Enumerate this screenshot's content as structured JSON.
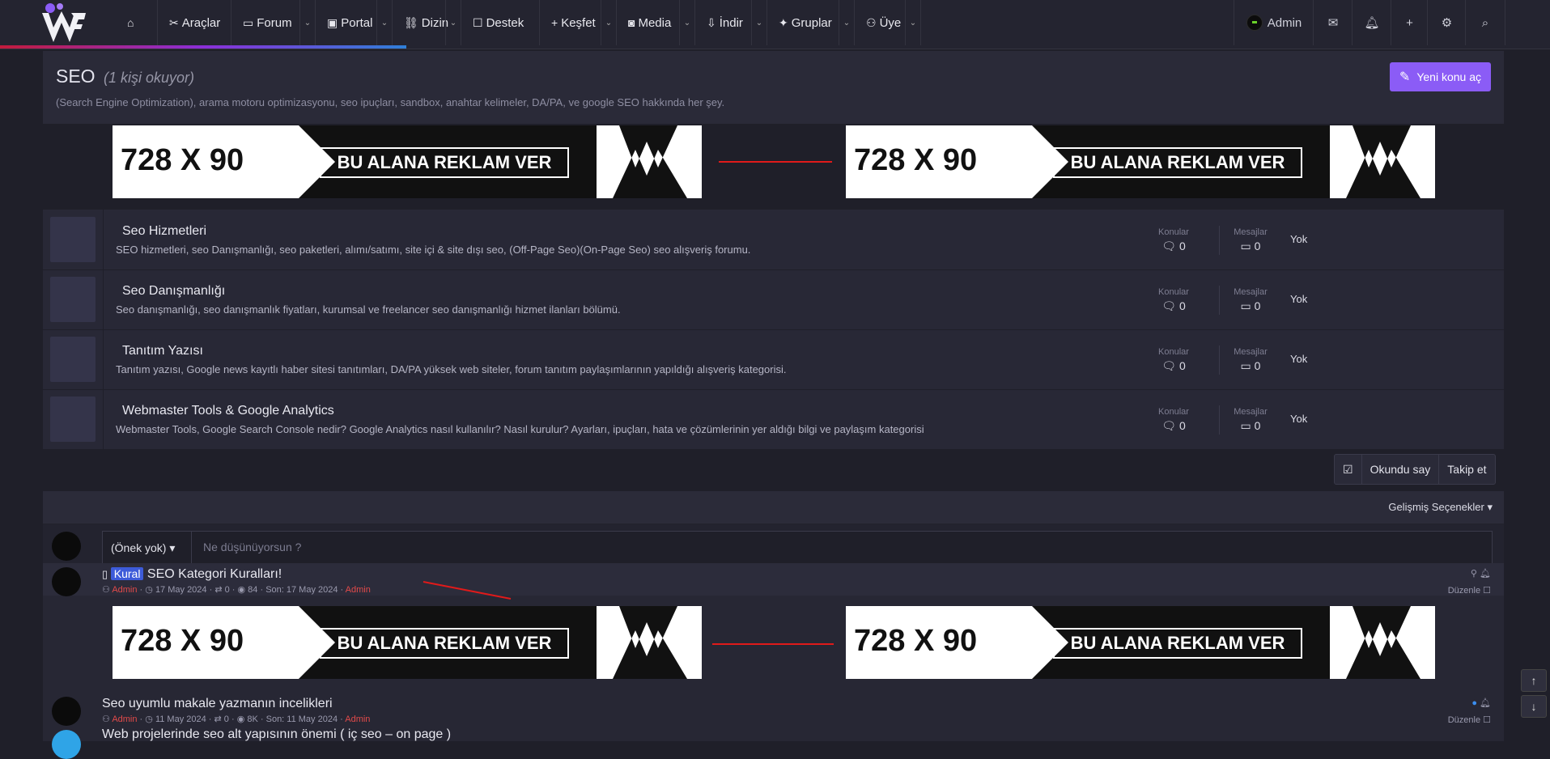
{
  "nav": {
    "items": [
      {
        "label": "Araçlar",
        "icon": "tools-icon",
        "dropdown": false
      },
      {
        "label": "Forum",
        "icon": "comment-icon",
        "dropdown": true
      },
      {
        "label": "Portal",
        "icon": "portal-icon",
        "dropdown": true
      },
      {
        "label": "Dizin",
        "icon": "link-icon",
        "dropdown": true
      },
      {
        "label": "Destek",
        "icon": "support-icon",
        "dropdown": false
      },
      {
        "label": "Keşfet",
        "icon": "plus-icon",
        "dropdown": true
      },
      {
        "label": "Media",
        "icon": "camera-icon",
        "dropdown": true
      },
      {
        "label": "İndir",
        "icon": "download-icon",
        "dropdown": true
      },
      {
        "label": "Gruplar",
        "icon": "group-icon",
        "dropdown": true
      },
      {
        "label": "Üye",
        "icon": "members-icon",
        "dropdown": true
      }
    ],
    "user": "Admin"
  },
  "header": {
    "title": "SEO",
    "subtitle": "(1 kişi okuyor)",
    "description": "(Search Engine Optimization), arama motoru optimizasyonu, seo ipuçları, sandbox, anahtar kelimeler, DA/PA, ve google SEO hakkında her şey.",
    "new_thread": "Yeni konu aç"
  },
  "ads": {
    "size": "728 X 90",
    "slogan": "BU ALANA REKLAM VER"
  },
  "nodes": [
    {
      "title": "Seo Hizmetleri",
      "desc": "SEO hizmetleri, seo Danışmanlığı, seo paketleri, alımı/satımı, site içi & site dışı seo, (Off-Page Seo)(On-Page Seo) seo alışveriş forumu.",
      "threads": "0",
      "messages": "0",
      "last": "Yok"
    },
    {
      "title": "Seo Danışmanlığı",
      "desc": "Seo danışmanlığı, seo danışmanlık fiyatları, kurumsal ve freelancer seo danışmanlığı hizmet ilanları bölümü.",
      "threads": "0",
      "messages": "0",
      "last": "Yok"
    },
    {
      "title": "Tanıtım Yazısı",
      "desc": "Tanıtım yazısı, Google news kayıtlı haber sitesi tanıtımları, DA/PA yüksek web siteler, forum tanıtım paylaşımlarının yapıldığı alışveriş kategorisi.",
      "threads": "0",
      "messages": "0",
      "last": "Yok"
    },
    {
      "title": "Webmaster Tools & Google Analytics",
      "desc": "Webmaster Tools, Google Search Console nedir? Google Analytics nasıl kullanılır? Nasıl kurulur? Ayarları, ipuçları, hata ve çözümlerinin yer aldığı bilgi ve paylaşım kategorisi",
      "threads": "0",
      "messages": "0",
      "last": "Yok"
    }
  ],
  "stat_labels": {
    "threads": "Konular",
    "messages": "Mesajlar"
  },
  "actions": {
    "mark_read": "Okundu say",
    "watch": "Takip et"
  },
  "filter": {
    "advanced": "Gelişmiş Seçenekler"
  },
  "quick_thread": {
    "prefix": "(Önek yok)",
    "placeholder": "Ne düşünüyorsun ?"
  },
  "threads": [
    {
      "badge": "Kural",
      "title": "SEO Kategori Kuralları!",
      "author": "Admin",
      "date": "17 May 2024",
      "replies": "0",
      "views": "84",
      "last_label": "Son: 17 May 2024",
      "last_user": "Admin",
      "edit": "Düzenle"
    },
    {
      "badge": "",
      "title": "Seo uyumlu makale yazmanın incelikleri",
      "author": "Admin",
      "date": "11 May 2024",
      "replies": "0",
      "views": "8K",
      "last_label": "Son: 11 May 2024",
      "last_user": "Admin",
      "edit": "Düzenle"
    },
    {
      "badge": "",
      "title": "Web projelerinde seo alt yapısının önemi ( iç seo – on page )",
      "author": "",
      "date": "",
      "replies": "",
      "views": "",
      "last_label": "",
      "last_user": "",
      "edit": ""
    }
  ],
  "colors": {
    "accent": "#8b5cf6",
    "bg": "#1f1f29",
    "panel": "#282836",
    "user": "#e24a4a",
    "arrow": "#e01a1a"
  }
}
